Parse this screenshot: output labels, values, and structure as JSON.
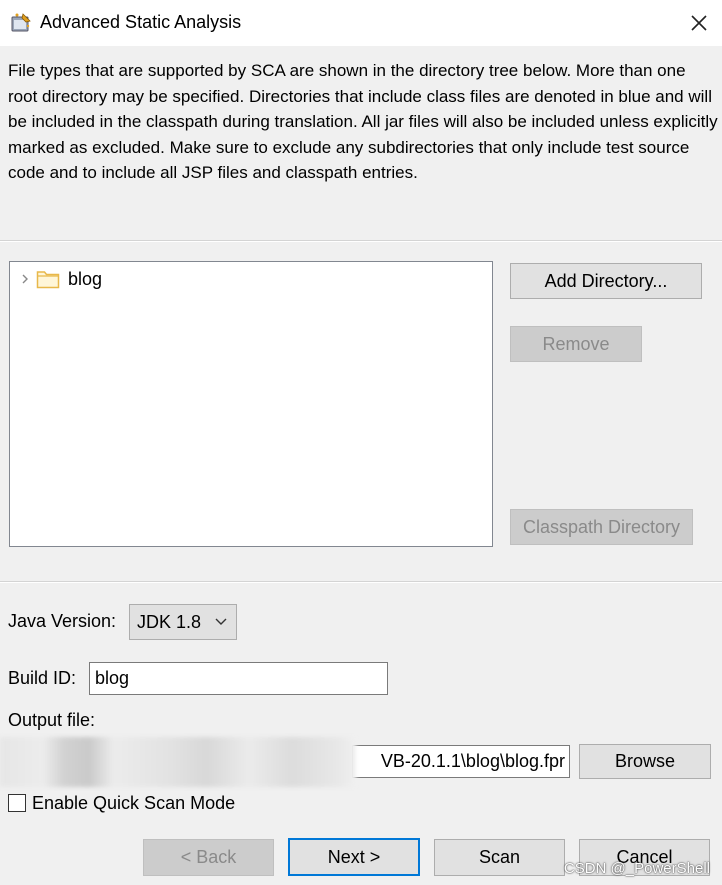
{
  "window": {
    "title": "Advanced Static Analysis",
    "icon": "wizard-icon",
    "close_icon": "close-icon"
  },
  "description": "File types that are supported by SCA are shown in the directory tree below. More than one root directory may be specified. Directories that include class files are denoted in blue and will be included in the classpath during translation. All jar files will also be included unless explicitly marked as excluded.  Make sure to exclude any subdirectories that only include test source code and to include all JSP files and classpath entries.",
  "tree": {
    "items": [
      {
        "label": "blog",
        "icon": "folder-icon",
        "expanded": false
      }
    ]
  },
  "side_buttons": {
    "add_directory": "Add Directory...",
    "remove": "Remove",
    "classpath_directory": "Classpath Directory"
  },
  "java_version": {
    "label": "Java Version:",
    "selected": "JDK 1.8"
  },
  "build_id": {
    "label": "Build ID:",
    "value": "blog"
  },
  "output_file": {
    "label": "Output file:",
    "value": "VB-20.1.1\\blog\\blog.fpr",
    "browse": "Browse"
  },
  "quick_scan": {
    "label": "Enable Quick Scan Mode",
    "checked": false
  },
  "footer_buttons": {
    "back": "< Back",
    "next": "Next >",
    "scan": "Scan",
    "cancel": "Cancel"
  },
  "watermark": "CSDN @_PowerShell",
  "colors": {
    "dialog_bg": "#f0f0f0",
    "focus_border": "#0078d7",
    "folder": "#e8b84a"
  }
}
